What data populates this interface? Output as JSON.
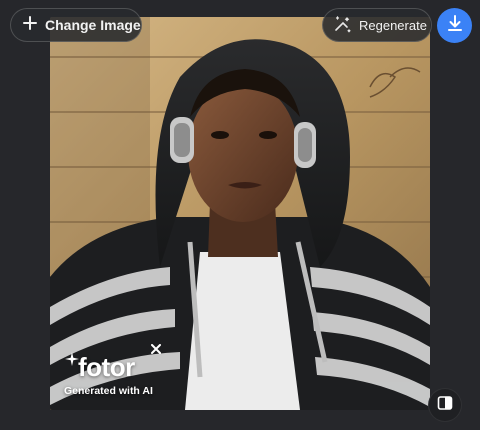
{
  "toolbar": {
    "change_image_label": "Change Image",
    "regenerate_label": "Regenerate"
  },
  "watermark": {
    "logo_text": "fotor",
    "generated_label": "Generated with AI"
  },
  "icons": {
    "change_image": "plus-icon",
    "regenerate": "sparkle-regenerate-icon",
    "download": "download-icon",
    "compare": "compare-split-icon",
    "close_watermark": "close-icon"
  },
  "colors": {
    "background": "#26272b",
    "accent": "#3b82f6"
  }
}
